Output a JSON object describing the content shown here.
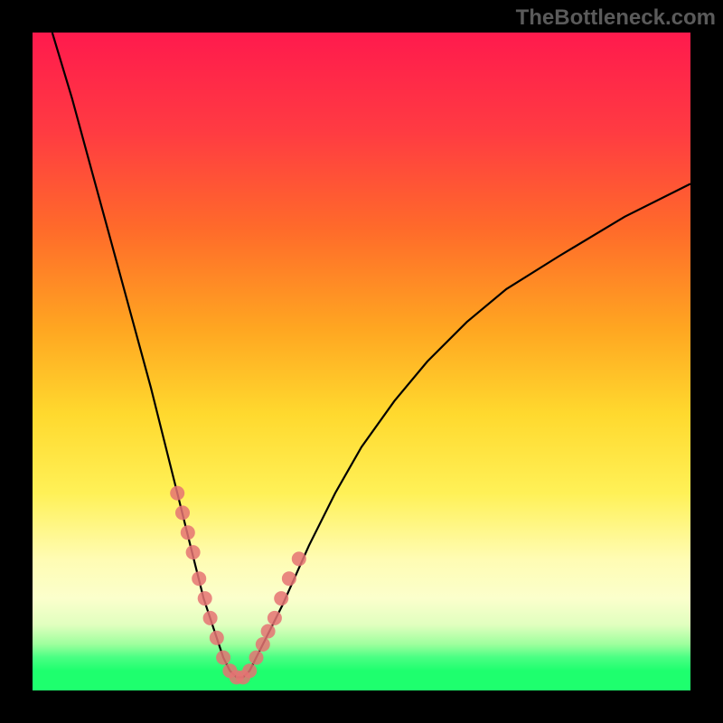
{
  "watermark": "TheBottleneck.com",
  "chart_data": {
    "type": "line",
    "title": "",
    "xlabel": "",
    "ylabel": "",
    "xlim": [
      0,
      100
    ],
    "ylim": [
      0,
      100
    ],
    "grid": false,
    "legend": false,
    "series": [
      {
        "name": "bottleneck-curve",
        "x": [
          3,
          6,
          9,
          12,
          15,
          18,
          20,
          22,
          24,
          26,
          28,
          29,
          30,
          31,
          32,
          33,
          34,
          36,
          38,
          42,
          46,
          50,
          55,
          60,
          66,
          72,
          80,
          90,
          100
        ],
        "y": [
          100,
          90,
          79,
          68,
          57,
          46,
          38,
          30,
          22,
          14,
          8,
          5,
          3,
          2,
          2,
          3,
          5,
          9,
          13,
          22,
          30,
          37,
          44,
          50,
          56,
          61,
          66,
          72,
          77
        ]
      }
    ],
    "markers": {
      "name": "highlighted-points",
      "x": [
        22.0,
        22.8,
        23.6,
        24.4,
        25.3,
        26.2,
        27.0,
        28.0,
        29.0,
        30.0,
        31.0,
        32.0,
        33.0,
        34.0,
        35.0,
        35.8,
        36.8,
        37.8,
        39.0,
        40.5
      ],
      "y": [
        30,
        27,
        24,
        21,
        17,
        14,
        11,
        8,
        5,
        3,
        2,
        2,
        3,
        5,
        7,
        9,
        11,
        14,
        17,
        20
      ]
    },
    "background_gradient": [
      "#ff1a4d",
      "#ff6b2a",
      "#ffd92e",
      "#fffcb3",
      "#1eff6e"
    ]
  }
}
